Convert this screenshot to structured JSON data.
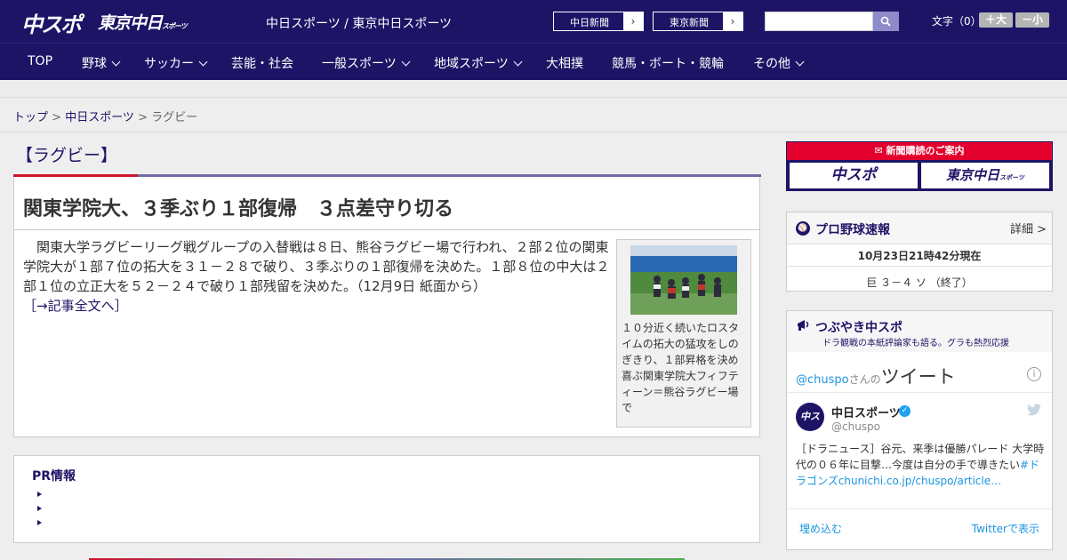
{
  "header": {
    "logo_main": "中スポ",
    "logo_tokyo": "東京中日",
    "logo_tokyo_small": "スポーツ",
    "site_name": "中日スポーツ / 東京中日スポーツ",
    "ext_links": [
      "中日新聞",
      "東京新聞"
    ],
    "search_placeholder": "",
    "font_label": "文字（0）",
    "font_bigger": "＋大",
    "font_smaller": "－小"
  },
  "nav": {
    "items": [
      {
        "label": "TOP",
        "dropdown": false
      },
      {
        "label": "野球",
        "dropdown": true
      },
      {
        "label": "サッカー",
        "dropdown": true
      },
      {
        "label": "芸能・社会",
        "dropdown": false
      },
      {
        "label": "一般スポーツ",
        "dropdown": true
      },
      {
        "label": "地域スポーツ",
        "dropdown": true
      },
      {
        "label": "大相撲",
        "dropdown": false
      },
      {
        "label": "競馬・ボート・競輪",
        "dropdown": false
      },
      {
        "label": "その他",
        "dropdown": true
      }
    ]
  },
  "breadcrumb": {
    "home": "トップ",
    "section": "中日スポーツ",
    "current": "ラグビー",
    "sep": " > "
  },
  "article": {
    "category": "【ラグビー】",
    "headline": "関東学院大、３季ぶり１部復帰　３点差守り切る",
    "body": "関東大学ラグビーリーグ戦グループの入替戦は８日、熊谷ラグビー場で行われ、２部２位の関東学院大が１部７位の拓大を３１－２８で破り、３季ぶりの１部復帰を決めた。１部８位の中大は２部１位の立正大を５２－２４で破り１部残留を決めた。（12月9日 紙面から）",
    "more_link": "［→記事全文へ］",
    "caption": "１０分近く続いたロスタイムの拓大の猛攻をしのぎきり、１部昇格を決め喜ぶ関東学院大フィフティーン＝熊谷ラグビー場で"
  },
  "pr": {
    "title": "PR情報",
    "items": [
      "",
      "",
      ""
    ]
  },
  "sidebar": {
    "subscribe_head": "新聞購読のご案内",
    "subscribe_btns": [
      "中スポ",
      "東京中日"
    ],
    "subscribe_small": "スポーツ",
    "baseball": {
      "title": "プロ野球速報",
      "detail": "詳細 >",
      "time": "10月23日21時42分現在",
      "score": "巨 ３－４ ソ （終了）"
    },
    "tweets": {
      "title": "つぶやき中スポ",
      "subtitle": "ドラ観戦の本紙評論家も語る。グラも熱烈応援",
      "at_handle": "@chuspo",
      "at_san": "さんの",
      "at_big": "ツイート",
      "name": "中日スポーツ",
      "handle": "@chuspo",
      "avatar": "中ス",
      "text_pre": "［ドラニュース］谷元、来季は優勝パレード 大学時代の０６年に目撃…今度は自分の手で導きたい",
      "text_link": "#ドラゴンズchunichi.co.jp/chuspo/article…",
      "embed": "埋め込む",
      "view": "Twitterで表示"
    }
  },
  "colors": {
    "brand_navy": "#1e1466",
    "accent_red": "#d0112b",
    "twitter_blue": "#1b95e0"
  }
}
